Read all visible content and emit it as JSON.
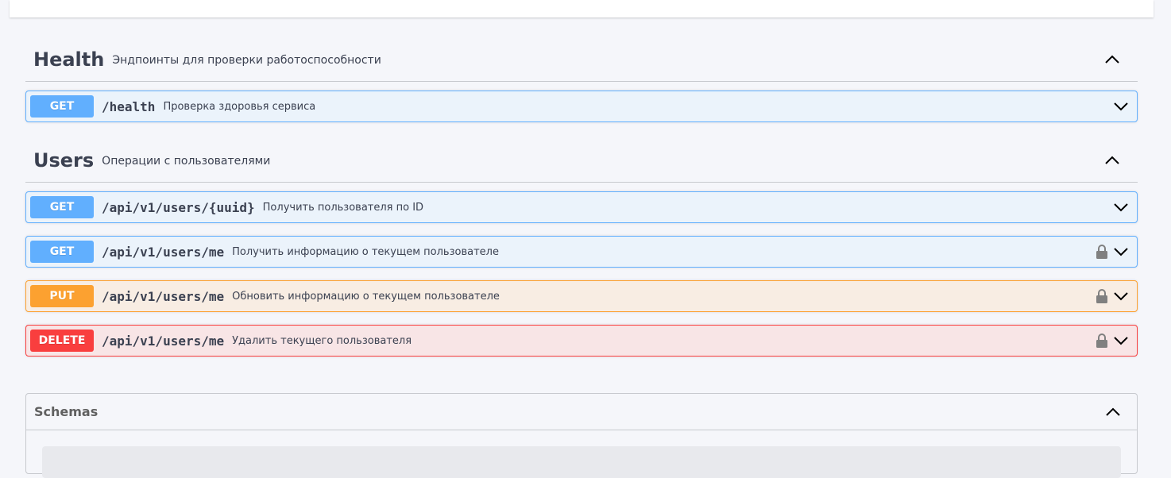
{
  "tags": [
    {
      "name": "Health",
      "description": "Эндпоинты для проверки работоспособности",
      "operations": [
        {
          "method": "GET",
          "path": "/health",
          "summary": "Проверка здоровья сервиса",
          "locked": false
        }
      ]
    },
    {
      "name": "Users",
      "description": "Операции с пользователями",
      "operations": [
        {
          "method": "GET",
          "path": "/api/v1/users/{uuid}",
          "summary": "Получить пользователя по ID",
          "locked": false
        },
        {
          "method": "GET",
          "path": "/api/v1/users/me",
          "summary": "Получить информацию о текущем пользователе",
          "locked": true
        },
        {
          "method": "PUT",
          "path": "/api/v1/users/me",
          "summary": "Обновить информацию о текущем пользователе",
          "locked": true
        },
        {
          "method": "DELETE",
          "path": "/api/v1/users/me",
          "summary": "Удалить текущего пользователя",
          "locked": true
        }
      ]
    }
  ],
  "schemas": {
    "title": "Schemas"
  },
  "colors": {
    "get": "#61affe",
    "put": "#fca130",
    "delete": "#f93e3e",
    "text": "#3b4151"
  },
  "icons": {
    "collapse": "chevron-up-icon",
    "expand": "chevron-down-icon",
    "auth": "lock-icon"
  }
}
